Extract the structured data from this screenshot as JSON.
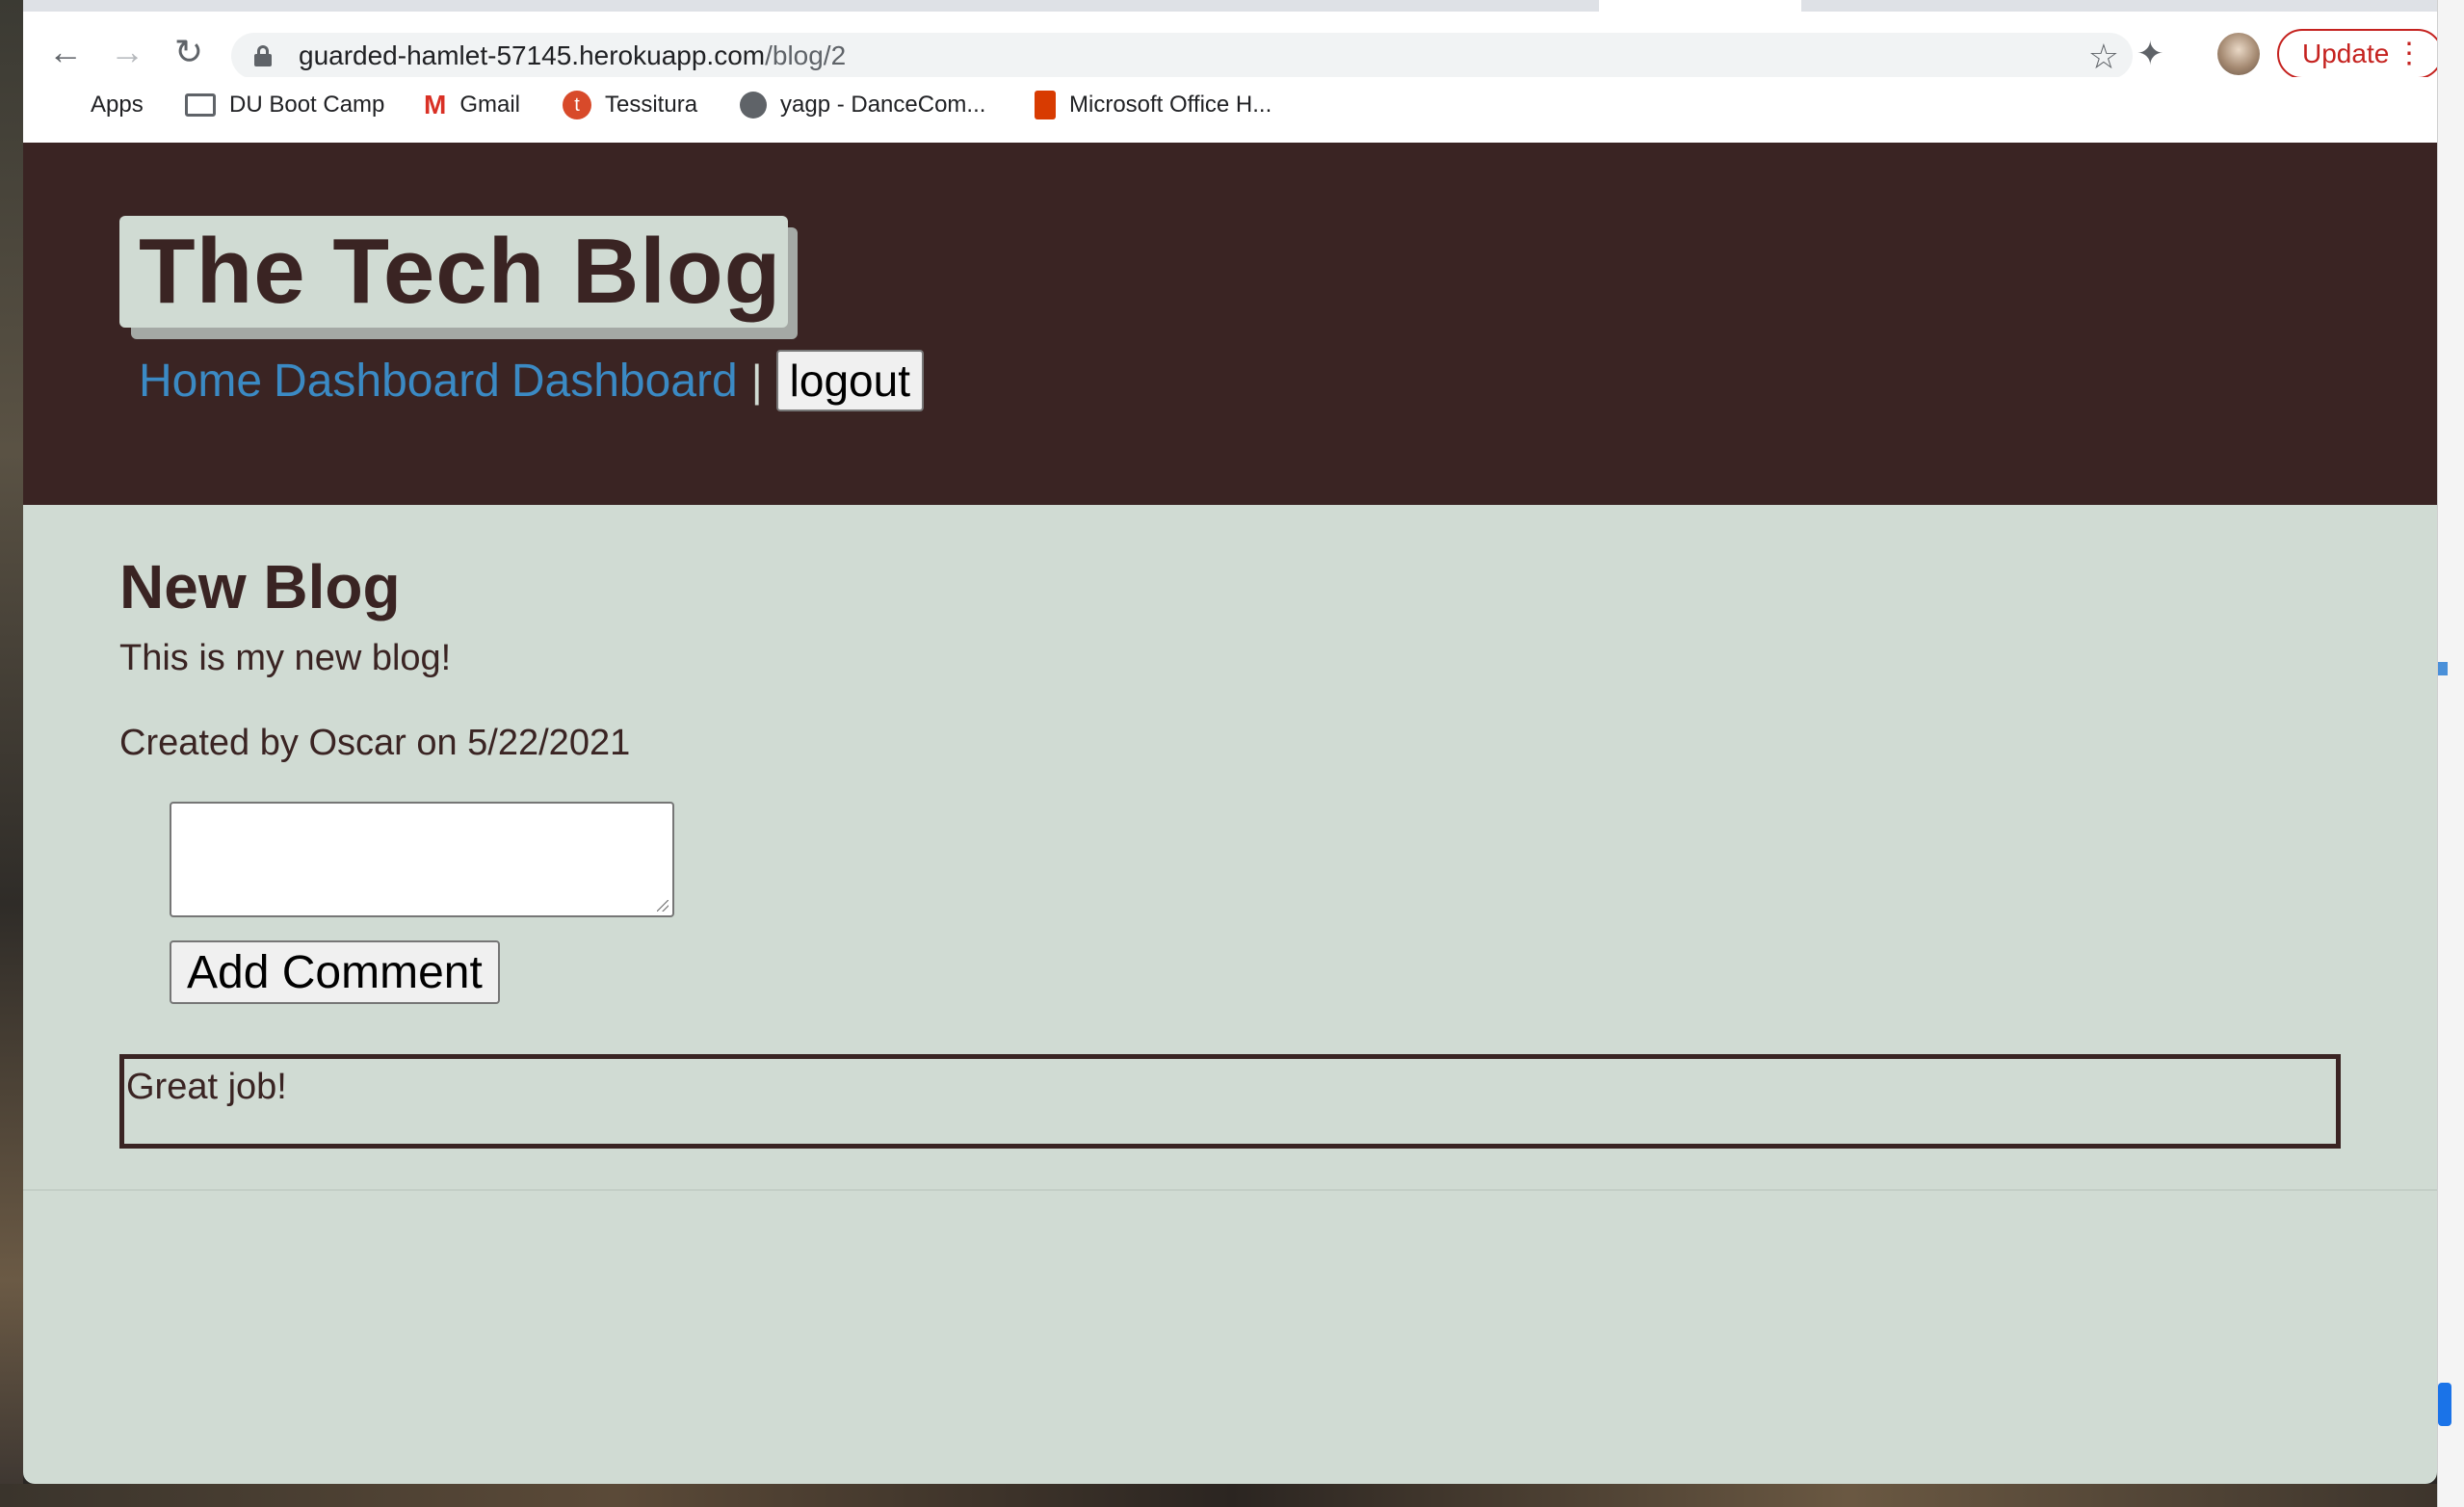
{
  "browser": {
    "url_host": "guarded-hamlet-57145.herokuapp.com",
    "url_path": "/blog/2",
    "update_label": "Update",
    "bookmarks": [
      {
        "label": "Apps",
        "icon": "apps-grid-icon"
      },
      {
        "label": "DU Boot Camp",
        "icon": "folder-icon"
      },
      {
        "label": "Gmail",
        "icon": "gmail-icon"
      },
      {
        "label": "Tessitura",
        "icon": "tessitura-icon"
      },
      {
        "label": "yagp - DanceCom...",
        "icon": "globe-icon"
      },
      {
        "label": "Microsoft Office H...",
        "icon": "office-icon"
      }
    ]
  },
  "site": {
    "title": "The Tech Blog",
    "nav": {
      "home": "Home",
      "dashboard_1": "Dashboard",
      "dashboard_2": "Dashboard",
      "separator": "|",
      "logout": "logout"
    }
  },
  "post": {
    "title": "New Blog",
    "body": "This is my new blog!",
    "meta": "Created by Oscar on 5/22/2021",
    "comment_input_value": "",
    "add_comment_label": "Add Comment",
    "comments": [
      "Great job!"
    ]
  },
  "colors": {
    "header_bg": "#3a2423",
    "page_bg": "#d0dbd3",
    "link": "#3b8ac4",
    "update_red": "#c5221f"
  }
}
